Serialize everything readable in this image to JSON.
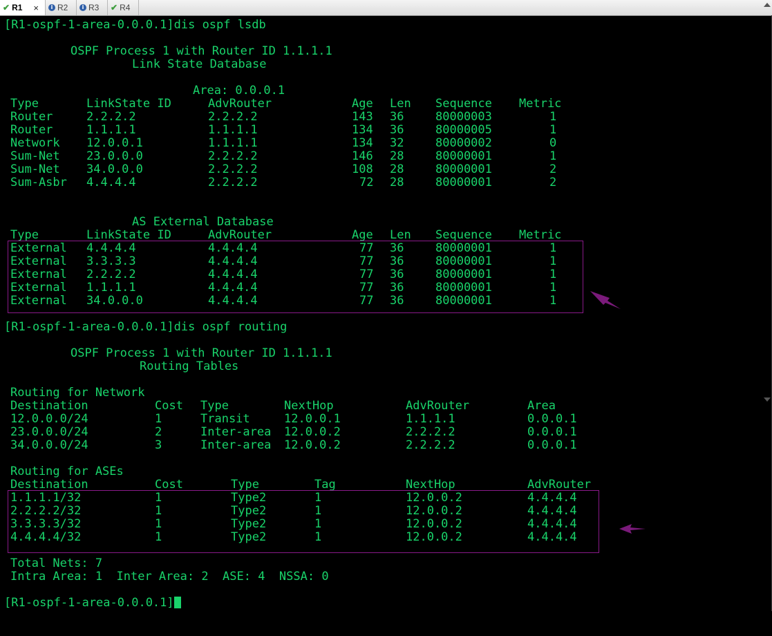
{
  "tabs": [
    {
      "label": "R1",
      "icon": "check-icon",
      "active": true,
      "close": "×"
    },
    {
      "label": "R2",
      "icon": "info-icon"
    },
    {
      "label": "R3",
      "icon": "info-icon"
    },
    {
      "label": "R4",
      "icon": "check-icon"
    }
  ],
  "colors": {
    "terminal_text": "#19d36a",
    "terminal_bg": "#000000",
    "highlight_box": "#8a1a8a",
    "arrow": "#7a1a7a"
  },
  "terminal": {
    "cmd1": "[R1-ospf-1-area-0.0.0.1]dis ospf lsdb",
    "lsdb_header": "OSPF Process 1 with Router ID 1.1.1.1",
    "lsdb_title": "Link State Database",
    "area": "Area: 0.0.0.1",
    "lsdb_columns": [
      "Type",
      "LinkState ID",
      "AdvRouter",
      "Age",
      "Len",
      "Sequence",
      "Metric"
    ],
    "lsdb_rows": [
      [
        "Router",
        "2.2.2.2",
        "2.2.2.2",
        "143",
        "36",
        "80000003",
        "1"
      ],
      [
        "Router",
        "1.1.1.1",
        "1.1.1.1",
        "134",
        "36",
        "80000005",
        "1"
      ],
      [
        "Network",
        "12.0.0.1",
        "1.1.1.1",
        "134",
        "32",
        "80000002",
        "0"
      ],
      [
        "Sum-Net",
        "23.0.0.0",
        "2.2.2.2",
        "146",
        "28",
        "80000001",
        "1"
      ],
      [
        "Sum-Net",
        "34.0.0.0",
        "2.2.2.2",
        "108",
        "28",
        "80000001",
        "2"
      ],
      [
        "Sum-Asbr",
        "4.4.4.4",
        "2.2.2.2",
        "72",
        "28",
        "80000001",
        "2"
      ]
    ],
    "ase_title": "AS External Database",
    "ase_rows": [
      [
        "External",
        "4.4.4.4",
        "4.4.4.4",
        "77",
        "36",
        "80000001",
        "1"
      ],
      [
        "External",
        "3.3.3.3",
        "4.4.4.4",
        "77",
        "36",
        "80000001",
        "1"
      ],
      [
        "External",
        "2.2.2.2",
        "4.4.4.4",
        "77",
        "36",
        "80000001",
        "1"
      ],
      [
        "External",
        "1.1.1.1",
        "4.4.4.4",
        "77",
        "36",
        "80000001",
        "1"
      ],
      [
        "External",
        "34.0.0.0",
        "4.4.4.4",
        "77",
        "36",
        "80000001",
        "1"
      ]
    ],
    "cmd2": "[R1-ospf-1-area-0.0.0.1]dis ospf routing",
    "routing_header": "OSPF Process 1 with Router ID 1.1.1.1",
    "routing_title": "Routing Tables",
    "net_title": "Routing for Network",
    "net_columns": [
      "Destination",
      "Cost",
      "Type",
      "NextHop",
      "AdvRouter",
      "Area"
    ],
    "net_rows": [
      [
        "12.0.0.0/24",
        "1",
        "Transit",
        "12.0.0.1",
        "1.1.1.1",
        "0.0.0.1"
      ],
      [
        "23.0.0.0/24",
        "2",
        "Inter-area",
        "12.0.0.2",
        "2.2.2.2",
        "0.0.0.1"
      ],
      [
        "34.0.0.0/24",
        "3",
        "Inter-area",
        "12.0.0.2",
        "2.2.2.2",
        "0.0.0.1"
      ]
    ],
    "ases_title": "Routing for ASEs",
    "ases_columns": [
      "Destination",
      "Cost",
      "Type",
      "Tag",
      "NextHop",
      "AdvRouter"
    ],
    "ases_rows": [
      [
        "1.1.1.1/32",
        "1",
        "Type2",
        "1",
        "12.0.0.2",
        "4.4.4.4"
      ],
      [
        "2.2.2.2/32",
        "1",
        "Type2",
        "1",
        "12.0.0.2",
        "4.4.4.4"
      ],
      [
        "3.3.3.3/32",
        "1",
        "Type2",
        "1",
        "12.0.0.2",
        "4.4.4.4"
      ],
      [
        "4.4.4.4/32",
        "1",
        "Type2",
        "1",
        "12.0.0.2",
        "4.4.4.4"
      ]
    ],
    "total_nets": "Total Nets: 7",
    "summary": "Intra Area: 1  Inter Area: 2  ASE: 4  NSSA: 0",
    "prompt": "[R1-ospf-1-area-0.0.0.1]"
  }
}
